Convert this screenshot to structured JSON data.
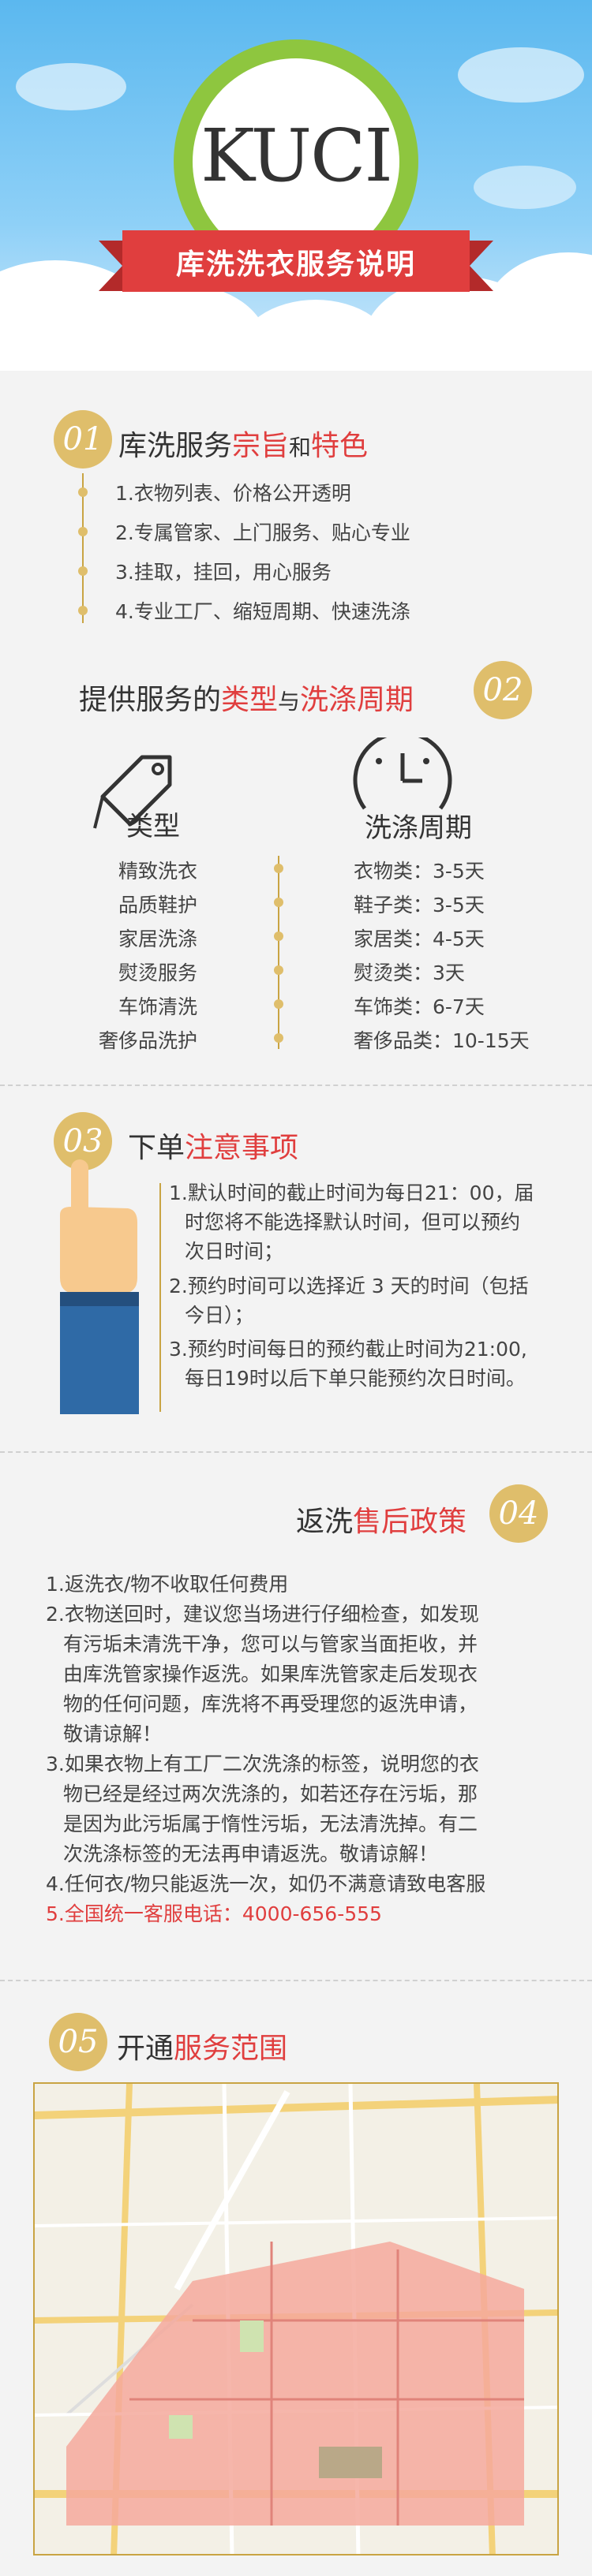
{
  "header": {
    "logo": "KUCI",
    "banner": "库洗洗衣服务说明"
  },
  "section1": {
    "number": "01",
    "title_a": "库洗服务",
    "title_b": "宗旨",
    "title_c": "和",
    "title_d": "特色",
    "items": [
      "1.衣物列表、价格公开透明",
      "2.专属管家、上门服务、贴心专业",
      "3.挂取，挂回，用心服务",
      "4.专业工厂、缩短周期、快速洗涤"
    ]
  },
  "section2": {
    "number": "02",
    "title_a": "提供服务的",
    "title_b": "类型",
    "title_c": "与",
    "title_d": "洗涤周期",
    "left_header": "类型",
    "right_header": "洗涤周期",
    "types": [
      "精致洗衣",
      "品质鞋护",
      "家居洗涤",
      "熨烫服务",
      "车饰清洗",
      "奢侈品洗护"
    ],
    "periods": [
      "衣物类：3-5天",
      "鞋子类：3-5天",
      "家居类：4-5天",
      "熨烫类：3天",
      "车饰类：6-7天",
      "奢侈品类：10-15天"
    ]
  },
  "section3": {
    "number": "03",
    "title_a": "下单",
    "title_b": "注意事项",
    "items": [
      [
        "1.默认时间的截止时间为每日21：00，届",
        "时您将不能选择默认时间，但可以预约",
        "次日时间；"
      ],
      [
        "2.预约时间可以选择近 3 天的时间（包括",
        "今日）；"
      ],
      [
        "3.预约时间每日的预约截止时间为21:00,",
        "每日19时以后下单只能预约次日时间。"
      ]
    ]
  },
  "section4": {
    "number": "04",
    "title_a": "返洗",
    "title_b": "售后政策",
    "items": [
      [
        "1.返洗衣/物不收取任何费用"
      ],
      [
        "2.衣物送回时，建议您当场进行仔细检查，如发现",
        "有污垢未清洗干净，您可以与管家当面拒收，并",
        "由库洗管家操作返洗。如果库洗管家走后发现衣",
        "物的任何问题，库洗将不再受理您的返洗申请，",
        "敬请谅解！"
      ],
      [
        "3.如果衣物上有工厂二次洗涤的标签，说明您的衣",
        "物已经是经过两次洗涤的，如若还存在污垢，那",
        "是因为此污垢属于惰性污垢，无法清洗掉。有二",
        "次洗涤标签的无法再申请返洗。敬请谅解！"
      ],
      [
        "4.任何衣/物只能返洗一次，如仍不满意请致电客服"
      ]
    ],
    "hotline": "5.全国统一客服电话：4000-656-555"
  },
  "section5": {
    "number": "05",
    "title_a": "开通",
    "title_b": "服务范围"
  },
  "colors": {
    "accent": "#e03e3e",
    "gold": "#dfbe6b",
    "green": "#8ec63f",
    "sky": "#5bb8ef"
  }
}
